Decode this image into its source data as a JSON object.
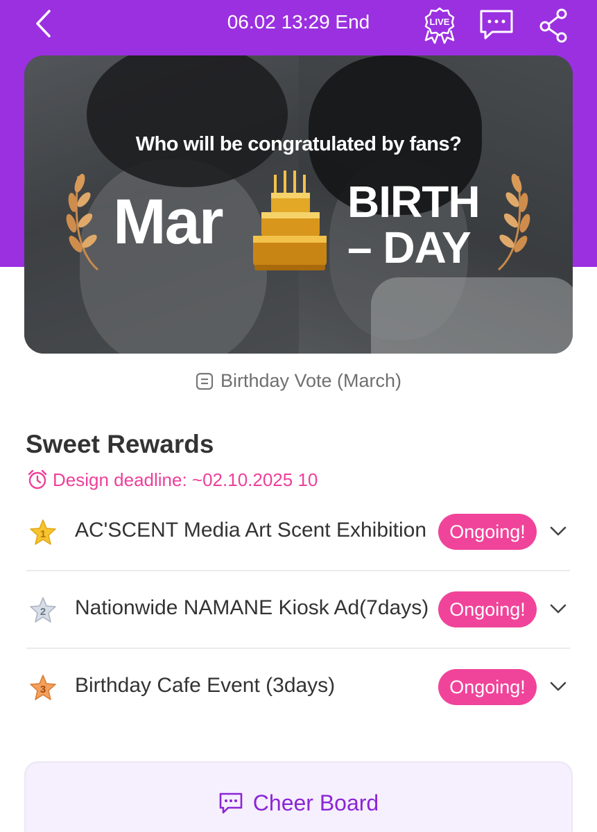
{
  "header": {
    "title": "06.02 13:29 End",
    "live_badge": "LIVE",
    "icons": [
      "back-chevron-icon",
      "live-icon",
      "chat-icon",
      "share-icon"
    ]
  },
  "banner": {
    "question": "Who will be congratulated by fans?",
    "month": "Mar",
    "birth_line1": "BIRTH",
    "birth_line2": "– DAY"
  },
  "vote": {
    "label": "Birthday Vote (March)"
  },
  "rewards": {
    "title": "Sweet Rewards",
    "deadline": "Design deadline: ~02.10.2025 10",
    "items": [
      {
        "rank": "1",
        "name": "AC'SCENT Media Art Scent Exhibition",
        "status": "Ongoing!"
      },
      {
        "rank": "2",
        "name": "Nationwide NAMANE Kiosk Ad(7days)",
        "status": "Ongoing!"
      },
      {
        "rank": "3",
        "name": "Birthday Cafe Event (3days)",
        "status": "Ongoing!"
      }
    ]
  },
  "cheer": {
    "label": "Cheer Board"
  },
  "colors": {
    "brand_purple": "#9b30e0",
    "ongoing_pink": "#f0449a",
    "deadline_pink": "#ee3f9a",
    "cheer_purple": "#8b25d6"
  }
}
